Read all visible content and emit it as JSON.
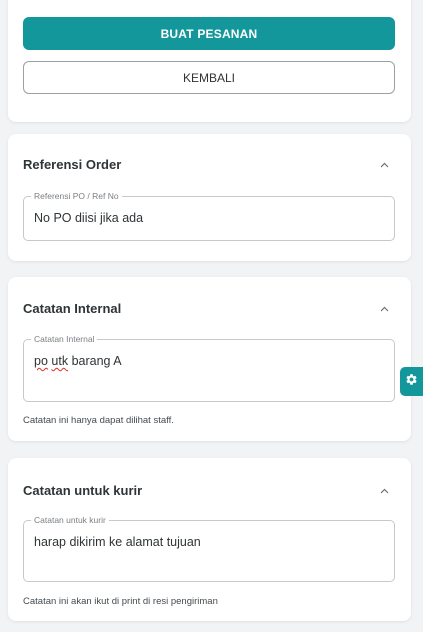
{
  "actions": {
    "primary_label": "BUAT PESANAN",
    "secondary_label": "KEMBALI"
  },
  "sections": {
    "referensi": {
      "title": "Referensi Order",
      "field_label": "Referensi PO / Ref No",
      "field_value": "No PO diisi jika ada"
    },
    "internal": {
      "title": "Catatan Internal",
      "field_label": "Catatan Internal",
      "field_value_word1": "po",
      "field_value_word2": "utk",
      "field_value_rest": "barang A",
      "helper": "Catatan ini hanya dapat dilihat staff."
    },
    "kurir": {
      "title": "Catatan untuk kurir",
      "field_label": "Catatan untuk kurir",
      "field_value": "harap dikirim ke alamat tujuan",
      "helper": "Catatan ini akan ikut di print di resi pengiriman"
    }
  },
  "icons": {
    "collapse": "chevron-up-icon",
    "settings": "gear-icon"
  },
  "colors": {
    "accent": "#14979a",
    "background": "#f1f3f5",
    "card": "#ffffff"
  }
}
